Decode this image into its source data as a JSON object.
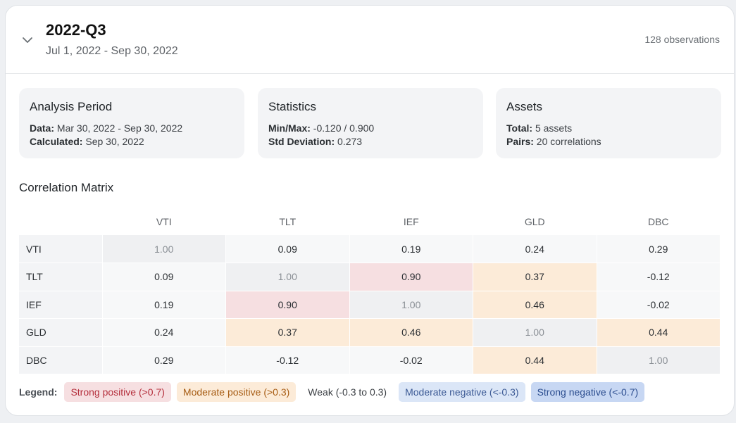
{
  "header": {
    "title": "2022-Q3",
    "dates": "Jul 1, 2022 - Sep 30, 2022",
    "observations": "128 observations",
    "collapse_icon": "chevron-down-icon"
  },
  "info": {
    "period": {
      "title": "Analysis Period",
      "line1_label": "Data:",
      "line1_value": " Mar 30, 2022 - Sep 30, 2022",
      "line2_label": "Calculated:",
      "line2_value": " Sep 30, 2022"
    },
    "stats": {
      "title": "Statistics",
      "line1_label": "Min/Max:",
      "line1_value": " -0.120 / 0.900",
      "line2_label": "Std Deviation:",
      "line2_value": " 0.273"
    },
    "assets": {
      "title": "Assets",
      "line1_label": "Total:",
      "line1_value": " 5 assets",
      "line2_label": "Pairs:",
      "line2_value": " 20 correlations"
    }
  },
  "matrix": {
    "title": "Correlation Matrix",
    "columns": [
      "VTI",
      "TLT",
      "IEF",
      "GLD",
      "DBC"
    ],
    "rows": [
      {
        "label": "VTI",
        "cells": [
          {
            "v": "1.00",
            "c": "diag"
          },
          {
            "v": "0.09",
            "c": "weak"
          },
          {
            "v": "0.19",
            "c": "weak"
          },
          {
            "v": "0.24",
            "c": "weak"
          },
          {
            "v": "0.29",
            "c": "weak"
          }
        ]
      },
      {
        "label": "TLT",
        "cells": [
          {
            "v": "0.09",
            "c": "weak"
          },
          {
            "v": "1.00",
            "c": "diag"
          },
          {
            "v": "0.90",
            "c": "strongpos"
          },
          {
            "v": "0.37",
            "c": "modpos"
          },
          {
            "v": "-0.12",
            "c": "weak"
          }
        ]
      },
      {
        "label": "IEF",
        "cells": [
          {
            "v": "0.19",
            "c": "weak"
          },
          {
            "v": "0.90",
            "c": "strongpos"
          },
          {
            "v": "1.00",
            "c": "diag"
          },
          {
            "v": "0.46",
            "c": "modpos"
          },
          {
            "v": "-0.02",
            "c": "weak"
          }
        ]
      },
      {
        "label": "GLD",
        "cells": [
          {
            "v": "0.24",
            "c": "weak"
          },
          {
            "v": "0.37",
            "c": "modpos"
          },
          {
            "v": "0.46",
            "c": "modpos"
          },
          {
            "v": "1.00",
            "c": "diag"
          },
          {
            "v": "0.44",
            "c": "modpos"
          }
        ]
      },
      {
        "label": "DBC",
        "cells": [
          {
            "v": "0.29",
            "c": "weak"
          },
          {
            "v": "-0.12",
            "c": "weak"
          },
          {
            "v": "-0.02",
            "c": "weak"
          },
          {
            "v": "0.44",
            "c": "modpos"
          },
          {
            "v": "1.00",
            "c": "diag"
          }
        ]
      }
    ]
  },
  "legend": {
    "label": "Legend:",
    "items": [
      {
        "text": "Strong positive (>0.7)",
        "c": "strongpos"
      },
      {
        "text": "Moderate positive (>0.3)",
        "c": "modpos"
      },
      {
        "text": "Weak (-0.3 to 0.3)",
        "c": "weak"
      },
      {
        "text": "Moderate negative (<-0.3)",
        "c": "modneg"
      },
      {
        "text": "Strong negative (<-0.7)",
        "c": "strongneg"
      }
    ]
  },
  "colors": {
    "strong_positive_bg": "#f6dfe1",
    "moderate_positive_bg": "#fcebd8",
    "moderate_negative_bg": "#dbe6f7",
    "strong_negative_bg": "#c7d7f3",
    "diagonal_bg": "#eff0f2"
  }
}
